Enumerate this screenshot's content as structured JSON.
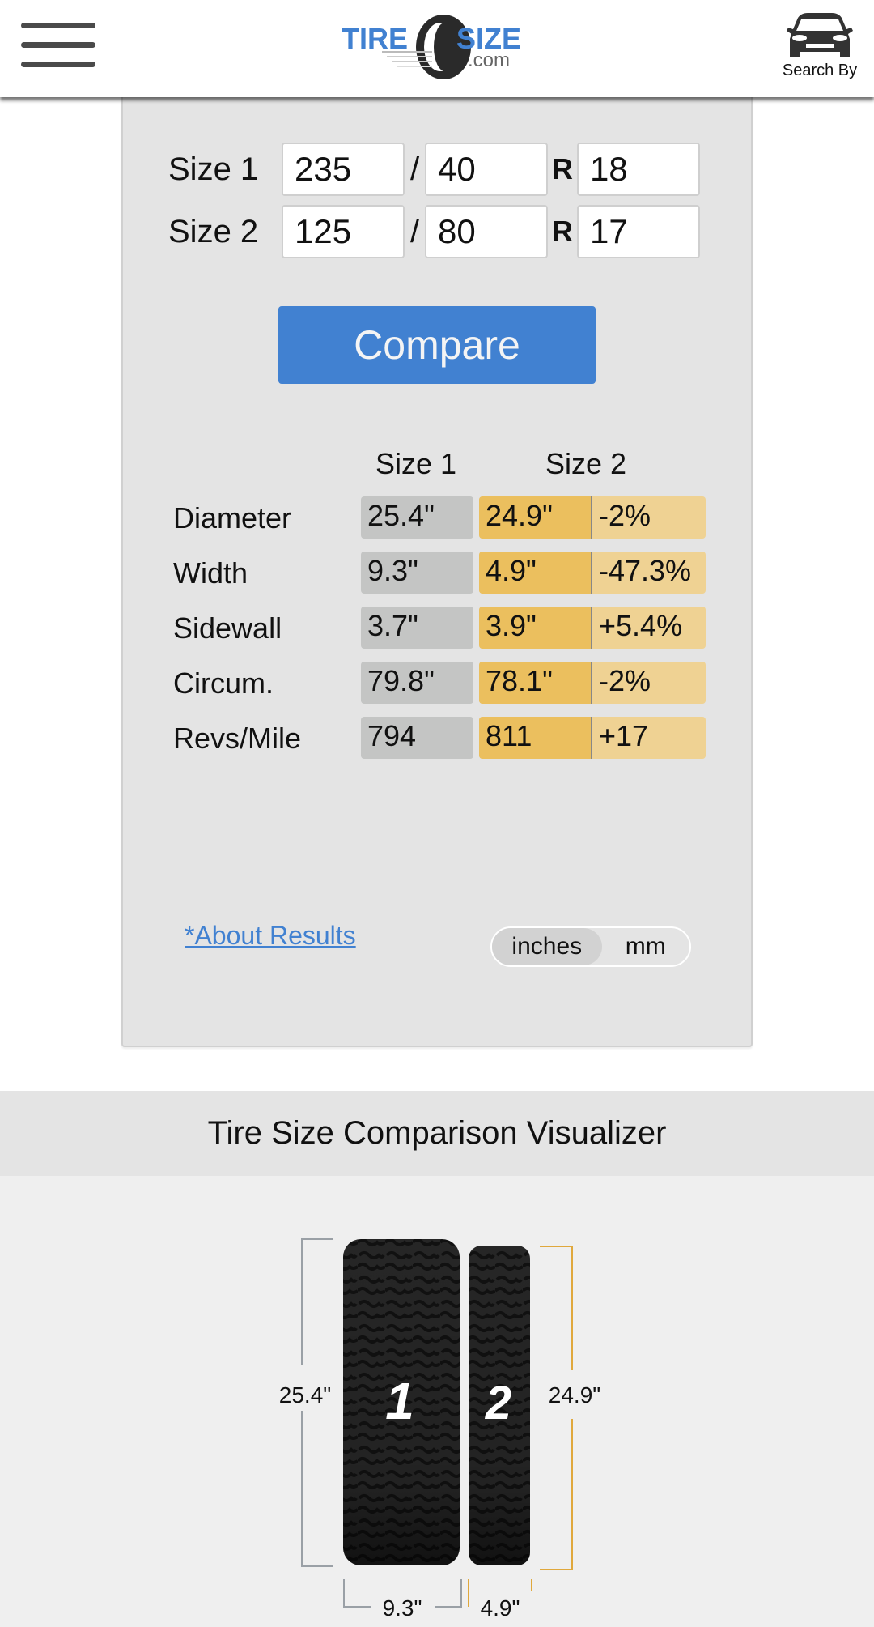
{
  "header": {
    "menu_icon": "hamburger-menu-icon",
    "logo": {
      "text_main_left": "TIRE",
      "text_main_right": "SIZE",
      "text_sub": ".com",
      "brand_color": "#4181d1"
    },
    "search_by": {
      "icon": "car-icon",
      "label": "Search By"
    }
  },
  "form": {
    "size1": {
      "label": "Size 1",
      "width": "235",
      "aspect": "40",
      "rim_sep": "R",
      "rim": "18"
    },
    "size2": {
      "label": "Size 2",
      "width": "125",
      "aspect": "80",
      "rim_sep": "R",
      "rim": "17"
    },
    "slash": "/",
    "compare_label": "Compare",
    "compare_color": "#4181d1"
  },
  "results": {
    "headers": {
      "size1": "Size 1",
      "size2": "Size 2"
    },
    "rows": [
      {
        "label": "Diameter",
        "size1": "25.4\"",
        "size2": "24.9\"",
        "diff": "-2%"
      },
      {
        "label": "Width",
        "size1": "9.3\"",
        "size2": "4.9\"",
        "diff": "-47.3%"
      },
      {
        "label": "Sidewall",
        "size1": "3.7\"",
        "size2": "3.9\"",
        "diff": "+5.4%"
      },
      {
        "label": "Circum.",
        "size1": "79.8\"",
        "size2": "78.1\"",
        "diff": "-2%"
      },
      {
        "label": "Revs/Mile",
        "size1": "794",
        "size2": "811",
        "diff": "+17"
      }
    ],
    "colors": {
      "size1": "#c4c5c4",
      "size2": "#ebbf5e",
      "diff": "#efd293"
    }
  },
  "footer_controls": {
    "about_link": "*About Results",
    "units": [
      {
        "label": "inches",
        "active": true
      },
      {
        "label": "mm",
        "active": false
      }
    ]
  },
  "visualizer": {
    "title": "Tire Size Comparison Visualizer",
    "tire1": {
      "number": "1",
      "diameter": "25.4\"",
      "width": "9.3\"",
      "diameter_value": 25.4,
      "width_value": 9.3,
      "bracket_color": "#9aa0a6"
    },
    "tire2": {
      "number": "2",
      "diameter": "24.9\"",
      "width": "4.9\"",
      "diameter_value": 24.9,
      "width_value": 4.9,
      "bracket_color": "#e0a83c"
    }
  }
}
